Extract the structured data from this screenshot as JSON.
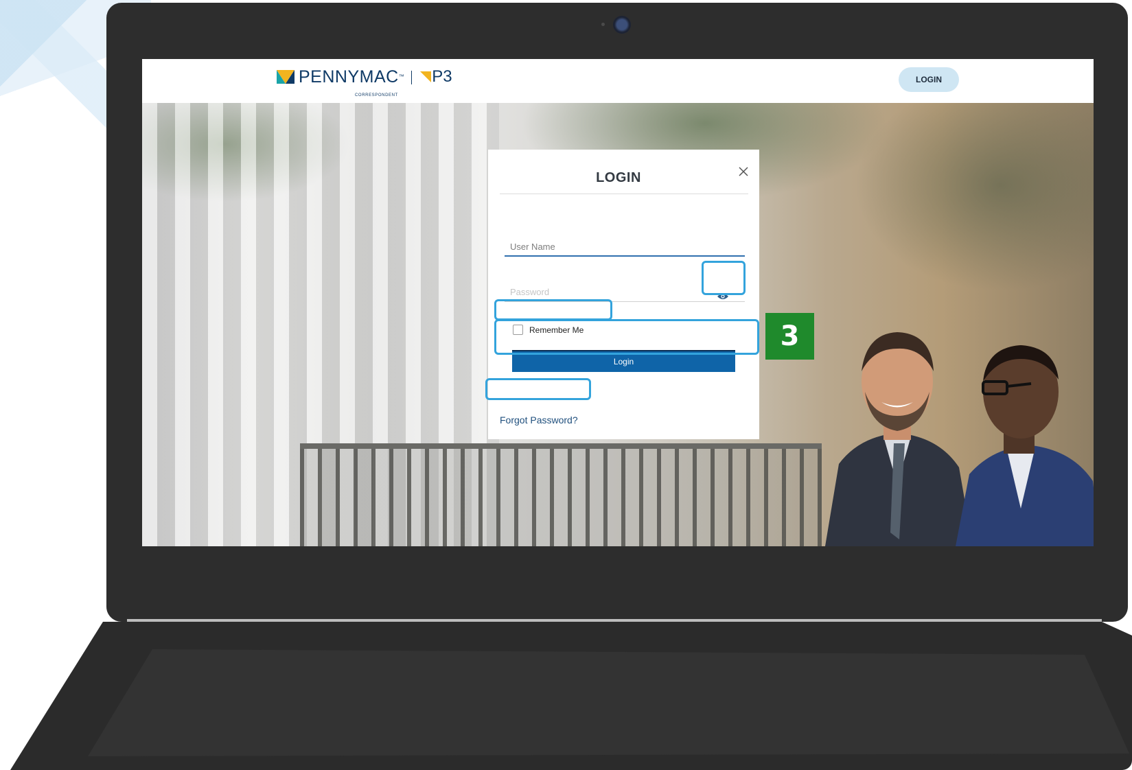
{
  "header": {
    "brand": "PENNYMAC",
    "brand_tm": "™",
    "brand_sub": "CORRESPONDENT",
    "product": "P3",
    "login_button": "LOGIN"
  },
  "login_modal": {
    "title": "LOGIN",
    "username_placeholder": "User Name",
    "password_placeholder": "Password",
    "remember_label": "Remember Me",
    "remember_checked": false,
    "submit_label": "Login",
    "forgot_link": "Forgot Password?"
  },
  "tutorial": {
    "step_number": "3"
  },
  "icons": {
    "close": "close-icon",
    "eye": "eye-icon",
    "camera": "camera-icon"
  },
  "colors": {
    "brand_navy": "#0f3a66",
    "brand_yellow": "#f2b41f",
    "brand_teal": "#1aa4a8",
    "primary_button": "#0f64a8",
    "highlight": "#33a3dc",
    "step_badge": "#1f8a2c",
    "header_login_bg": "#cfe6f3"
  }
}
